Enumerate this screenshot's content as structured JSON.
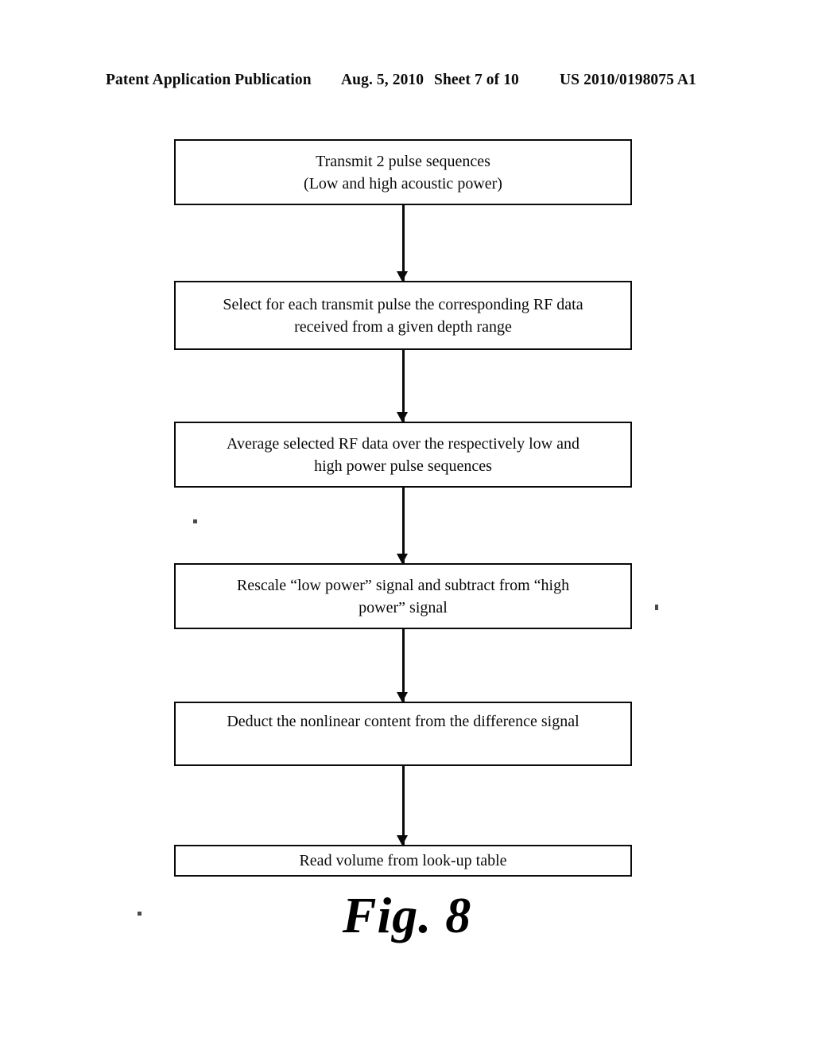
{
  "header": {
    "publication": "Patent Application Publication",
    "date": "Aug. 5, 2010",
    "sheet": "Sheet 7 of 10",
    "publication_number": "US 2010/0198075 A1"
  },
  "figure": {
    "caption": "Fig. 8",
    "type": "flowchart",
    "ink_color": "#0a0a0a",
    "background_color": "#ffffff"
  },
  "flowchart": {
    "nodes": [
      {
        "id": "node-1",
        "step": 1,
        "text": "Transmit 2 pulse sequences\n(Low and high acoustic power)",
        "lines": [
          "Transmit 2 pulse sequences",
          "(Low and high acoustic power)"
        ]
      },
      {
        "id": "node-2",
        "step": 2,
        "text": "Select for each transmit pulse the corresponding RF data\nreceived from a given depth range",
        "lines": [
          "Select for each transmit pulse the corresponding RF data",
          "received from a given depth range"
        ]
      },
      {
        "id": "node-3",
        "step": 3,
        "text": "Average selected RF data over the respectively low and\nhigh power pulse sequences",
        "lines": [
          "Average selected RF data over the respectively low and",
          "high power pulse sequences"
        ]
      },
      {
        "id": "node-4",
        "step": 4,
        "text": "Rescale “low power” signal and subtract from “high\npower” signal",
        "lines": [
          "Rescale “low power” signal and subtract from “high",
          "power” signal"
        ]
      },
      {
        "id": "node-5",
        "step": 5,
        "text": "Deduct the nonlinear content from the difference signal",
        "lines": [
          "Deduct the nonlinear content from the difference signal"
        ]
      },
      {
        "id": "node-6",
        "step": 6,
        "text": "Read volume from look-up table",
        "lines": [
          "Read volume from look-up table"
        ]
      }
    ],
    "connectors": [
      {
        "id": "conn-1",
        "from": "node-1",
        "to": "node-2",
        "direction": "down"
      },
      {
        "id": "conn-2",
        "from": "node-2",
        "to": "node-3",
        "direction": "down"
      },
      {
        "id": "conn-3",
        "from": "node-3",
        "to": "node-4",
        "direction": "down"
      },
      {
        "id": "conn-4",
        "from": "node-4",
        "to": "node-5",
        "direction": "down"
      },
      {
        "id": "conn-5",
        "from": "node-5",
        "to": "node-6",
        "direction": "down"
      }
    ]
  }
}
